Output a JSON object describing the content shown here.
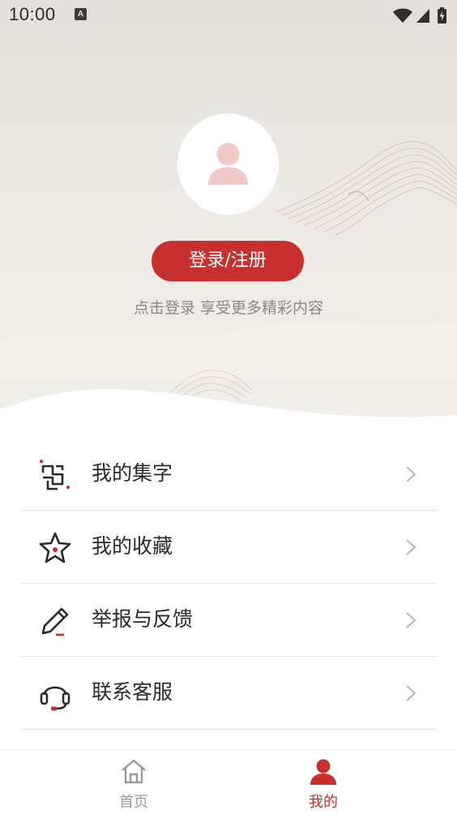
{
  "status_bar": {
    "time": "10:00",
    "notification_icon_letter": "A",
    "icons": [
      "wifi-icon",
      "signal-icon",
      "battery-icon"
    ]
  },
  "profile": {
    "avatar_icon": "user-icon",
    "login_button_label": "登录/注册",
    "login_hint": "点击登录 享受更多精彩内容"
  },
  "menu": {
    "items": [
      {
        "label": "我的集字",
        "icon": "collect-characters-icon"
      },
      {
        "label": "我的收藏",
        "icon": "star-icon"
      },
      {
        "label": "举报与反馈",
        "icon": "pencil-icon"
      },
      {
        "label": "联系客服",
        "icon": "headset-icon"
      }
    ]
  },
  "bottom_nav": {
    "tabs": [
      {
        "label": "首页",
        "icon": "home-icon",
        "active": false
      },
      {
        "label": "我的",
        "icon": "user-icon",
        "active": true
      }
    ]
  },
  "colors": {
    "accent": "#c7302e",
    "avatar_figure": "#f1c9c8",
    "inactive_tab": "#9a9a9a"
  }
}
